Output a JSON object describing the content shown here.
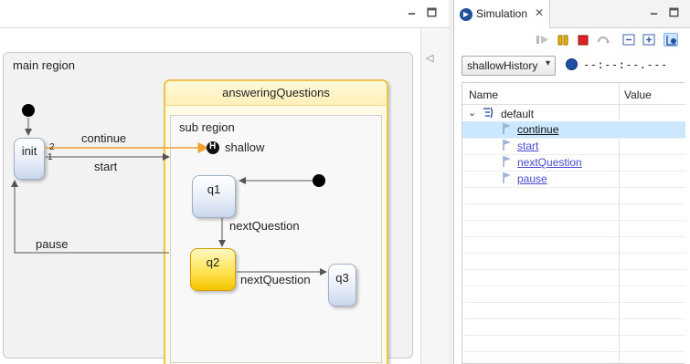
{
  "editor": {
    "window_buttons": {
      "minimize": "🗕",
      "maximize": "🗖"
    },
    "diagram": {
      "main_region_label": "main region",
      "composite_state_title": "answeringQuestions",
      "sub_region_label": "sub region",
      "history_label": "shallow",
      "history_symbol": "H",
      "states": {
        "init": "init",
        "q1": "q1",
        "q2": "q2",
        "q3": "q3"
      },
      "transitions": {
        "continue": "continue",
        "start": "start",
        "pause": "pause",
        "q1_to_q2": "nextQuestion",
        "q2_to_q3": "nextQuestion"
      },
      "priorities": {
        "first": "2",
        "second": "1"
      },
      "colors": {
        "active_state": "#ffe14a",
        "composite_header": "#fff4c8",
        "highlight_arrow": "#f0a030"
      }
    }
  },
  "simulation": {
    "tab_title": "Simulation",
    "tab_close": "✕",
    "toolbar": [
      "resume-icon",
      "suspend-icon",
      "terminate-icon",
      "step-icon",
      "collapse-all-icon",
      "expand-all-icon",
      "link-icon"
    ],
    "execution_dropdown": {
      "selected": "shallowHistory",
      "arrow": "▾"
    },
    "clock": "--:--:--.---",
    "tree": {
      "columns": {
        "name": "Name",
        "value": "Value"
      },
      "scope": "default",
      "events": [
        "continue",
        "start",
        "nextQuestion",
        "pause"
      ],
      "selected_event": "continue"
    },
    "colors": {
      "selection": "#cce8ff",
      "link": "#4a4ad0"
    }
  }
}
